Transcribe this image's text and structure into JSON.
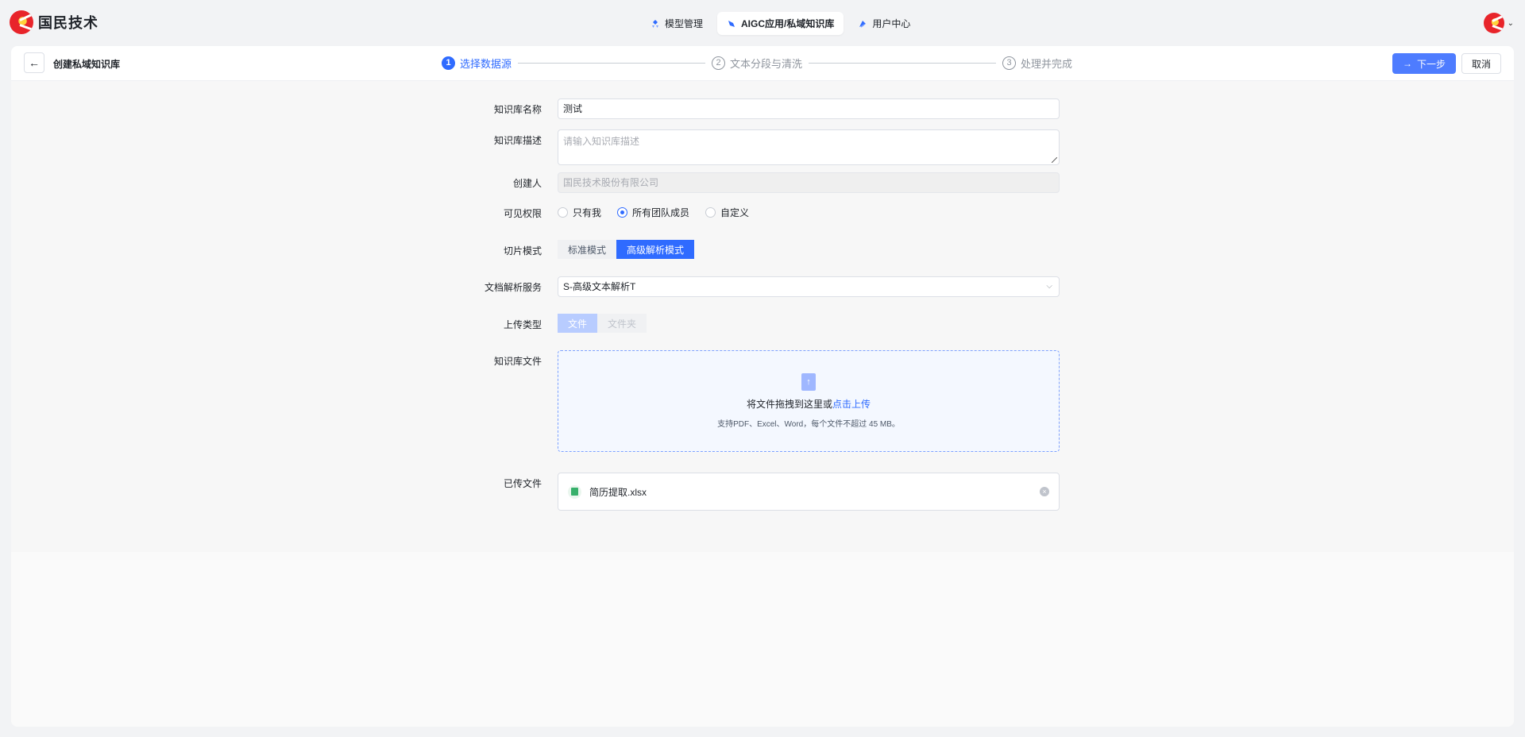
{
  "brand": {
    "name": "国民技术"
  },
  "nav": {
    "items": [
      {
        "label": "模型管理",
        "icon": "model-icon",
        "active": false
      },
      {
        "label": "AIGC应用/私域知识库",
        "icon": "aigc-icon",
        "active": true
      },
      {
        "label": "用户中心",
        "icon": "user-center-icon",
        "active": false
      }
    ]
  },
  "header": {
    "title": "创建私域知识库",
    "steps": [
      {
        "num": "1",
        "label": "选择数据源"
      },
      {
        "num": "2",
        "label": "文本分段与清洗"
      },
      {
        "num": "3",
        "label": "处理并完成"
      }
    ],
    "next_label": "下一步",
    "cancel_label": "取消"
  },
  "form": {
    "name": {
      "label": "知识库名称",
      "value": "测试"
    },
    "description": {
      "label": "知识库描述",
      "placeholder": "请输入知识库描述"
    },
    "creator": {
      "label": "创建人",
      "value": "国民技术股份有限公司"
    },
    "visibility": {
      "label": "可见权限",
      "options": [
        "只有我",
        "所有团队成员",
        "自定义"
      ],
      "selected": "所有团队成员"
    },
    "slice_mode": {
      "label": "切片模式",
      "options": [
        "标准模式",
        "高级解析模式"
      ],
      "selected": "高级解析模式"
    },
    "parser": {
      "label": "文档解析服务",
      "value": "S-高级文本解析T"
    },
    "upload_type": {
      "label": "上传类型",
      "options": [
        "文件",
        "文件夹"
      ],
      "selected": "文件"
    },
    "files": {
      "label": "知识库文件",
      "drop_text": "将文件拖拽到这里或",
      "drop_link": "点击上传",
      "hint": "支持PDF、Excel、Word，每个文件不超过 45 MB。"
    },
    "uploaded": {
      "label": "已传文件",
      "file_name": "简历提取.xlsx"
    }
  },
  "colors": {
    "accent": "#2f6bff",
    "button": "#4e7cff",
    "logo_red": "#e8242a"
  }
}
